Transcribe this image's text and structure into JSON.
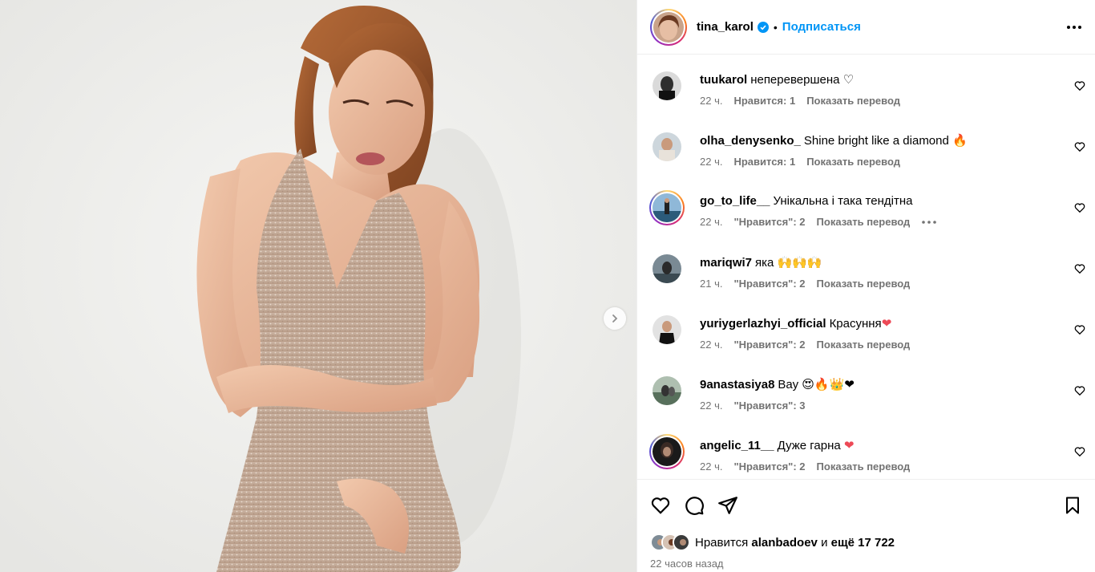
{
  "post": {
    "image_alt": "Фото от tina_karol"
  },
  "header": {
    "username": "tina_karol",
    "separator": "•",
    "follow_label": "Подписаться"
  },
  "comments": [
    {
      "user": "tuukarol",
      "text": "неперевершена",
      "emoji": "♡",
      "time": "22 ч.",
      "likes": "Нравится: 1",
      "translate": "Показать перевод",
      "has_more": false
    },
    {
      "user": "olha_denysenko_",
      "text": "Shine bright like a diamond",
      "emoji": "🔥",
      "time": "22 ч.",
      "likes": "Нравится: 1",
      "translate": "Показать перевод",
      "has_more": false
    },
    {
      "user": "go_to_life__",
      "text": "Унікальна і така тендітна",
      "emoji": "",
      "time": "22 ч.",
      "likes": "\"Нравится\": 2",
      "translate": "Показать перевод",
      "has_more": true
    },
    {
      "user": "mariqwi7",
      "text": "яка",
      "emoji": "🙌🙌🙌",
      "time": "21 ч.",
      "likes": "\"Нравится\": 2",
      "translate": "Показать перевод",
      "has_more": false
    },
    {
      "user": "yuriygerlazhyi_official",
      "text": "Красуння",
      "emoji": "❤",
      "time": "22 ч.",
      "likes": "\"Нравится\": 2",
      "translate": "Показать перевод",
      "has_more": false
    },
    {
      "user": "9anastasiya8",
      "text": "Вау",
      "emoji": "😍🔥👑❤",
      "time": "22 ч.",
      "likes": "\"Нравится\": 3",
      "translate": "",
      "has_more": false
    },
    {
      "user": "angelic_11__",
      "text": "Дуже гарна",
      "emoji": "❤",
      "time": "22 ч.",
      "likes": "\"Нравится\": 2",
      "translate": "Показать перевод",
      "has_more": false
    }
  ],
  "likes": {
    "prefix": "Нравится",
    "user": "alanbadoev",
    "conj": "и",
    "others": "ещё 17 722"
  },
  "timestamp": "22 часов назад",
  "colors": {
    "accent": "#0095f6",
    "secondary_text": "#737373",
    "heart_red": "#ed4956"
  }
}
